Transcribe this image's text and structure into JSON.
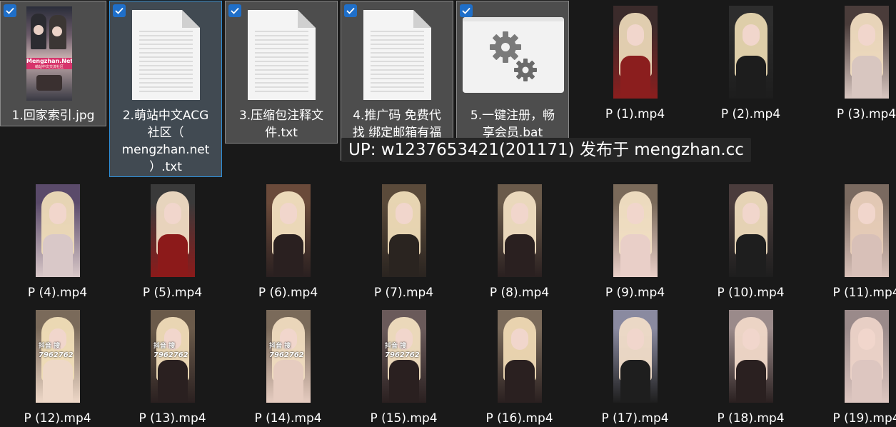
{
  "files": [
    {
      "name": "1.回家索引.jpg",
      "selected": true,
      "kind": "image"
    },
    {
      "name": "2.萌站中文ACG社区（mengzhan.net）.txt",
      "selected": true,
      "kind": "text"
    },
    {
      "name": "3.压缩包注释文件.txt",
      "selected": true,
      "kind": "text"
    },
    {
      "name": "4.推广码 免费代找 绑定邮箱有福利.txt",
      "selected": true,
      "kind": "text"
    },
    {
      "name": "5.一键注册，畅享会员.bat",
      "selected": true,
      "kind": "batch"
    }
  ],
  "labels": {
    "f1": "1.回家索引.jpg",
    "f2_l1": "2.萌站中文ACG",
    "f2_l2": "社区（",
    "f2_l3": "mengzhan.net",
    "f2_l4": "）.txt",
    "f3_l1": "3.压缩包注释文",
    "f3_l2": "件.txt",
    "f4_l1": "4.推广码 免费代",
    "f4_l2": "找 绑定邮箱有福",
    "f5_l1": "5.一键注册，畅",
    "f5_l2": "享会员.bat"
  },
  "thumb1_text": {
    "line1": "Mengzhan.Net",
    "line2": "萌站中文交流社区"
  },
  "overlay_text": "UP: w1237653421(201171) 发布于 mengzhan.cc",
  "videos": [
    "P (1).mp4",
    "P (2).mp4",
    "P (3).mp4",
    "P (4).mp4",
    "P (5).mp4",
    "P (6).mp4",
    "P (7).mp4",
    "P (8).mp4",
    "P (9).mp4",
    "P (10).mp4",
    "P (11).mp4",
    "P (12).mp4",
    "P (13).mp4",
    "P (14).mp4",
    "P (15).mp4",
    "P (16).mp4",
    "P (17).mp4",
    "P (18).mp4",
    "P (19).mp4"
  ],
  "video_watermarks": {
    "search_text": "抖音 搜",
    "code_text": "7962762"
  },
  "colors": {
    "background": "#191919",
    "selection": "#4d4d4d",
    "checkbox": "#1f6fc9",
    "overlay": "#262626"
  }
}
